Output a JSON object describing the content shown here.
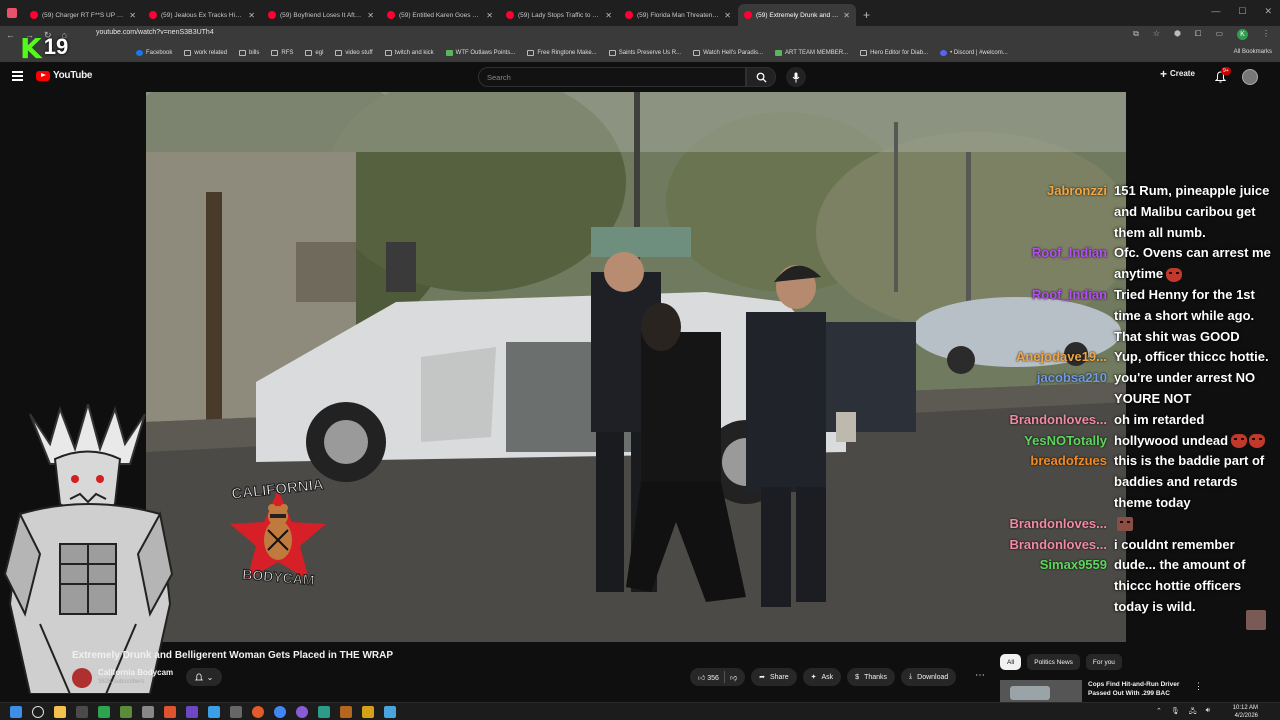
{
  "browser": {
    "tabs": [
      {
        "label": "(59) Charger RT F**S UP Calif"
      },
      {
        "label": "(59) Jealous Ex Tracks His Loser"
      },
      {
        "label": "(59) Boyfriend Loses It After He"
      },
      {
        "label": "(59) Entitled Karen Goes Ballist"
      },
      {
        "label": "(59) Lady Stops Traffic to Help I"
      },
      {
        "label": "(59) Florida Man Threatens Off"
      },
      {
        "label": "(59) Extremely Drunk and Bel"
      }
    ],
    "url": "youtube.com/watch?v=nenS3B3UTh4",
    "bookmarks": [
      {
        "label": "Facebook",
        "icon": "facebook-icon"
      },
      {
        "label": "work related",
        "icon": "folder-icon"
      },
      {
        "label": "bills",
        "icon": "folder-icon"
      },
      {
        "label": "RFS",
        "icon": "folder-icon"
      },
      {
        "label": "egl",
        "icon": "folder-icon"
      },
      {
        "label": "video stuff",
        "icon": "folder-icon"
      },
      {
        "label": "twitch and kick",
        "icon": "folder-icon"
      },
      {
        "label": "WTF Outlaws Points...",
        "icon": "green-icon"
      },
      {
        "label": "Free Ringtone Make...",
        "icon": "page-icon"
      },
      {
        "label": "Saints Preserve Us R...",
        "icon": "page-icon"
      },
      {
        "label": "Watch Hell's Paradis...",
        "icon": "page-icon"
      },
      {
        "label": "ART TEAM MEMBER...",
        "icon": "green-icon"
      },
      {
        "label": "Hero Editor for Diab...",
        "icon": "page-icon"
      },
      {
        "label": "• Discord | #welcom...",
        "icon": "discord-icon"
      }
    ],
    "all_bookmarks": "All Bookmarks",
    "profile_initial": "K"
  },
  "youtube": {
    "logo_text": "YouTube",
    "search_placeholder": "Search",
    "create_label": "Create",
    "notif_count": "9+"
  },
  "overlay": {
    "k_letter": "K",
    "counter": "19",
    "logo_top": "CALIFORNIA",
    "logo_bottom": "BODYCAM"
  },
  "chat": [
    {
      "user": "Jabronzzi",
      "color": "#f0a646",
      "text": "151 Rum, pineapple juice and Malibu caribou get them all numb."
    },
    {
      "user": "Roof_Indian",
      "color": "#b44ef0",
      "text": "Ofc. Ovens can arrest me anytime",
      "emote": true
    },
    {
      "user": "Roof_Indian",
      "color": "#b44ef0",
      "text": "Tried Henny for the 1st time a short while ago. That shit was GOOD"
    },
    {
      "user": "Anejodave19...",
      "color": "#f0a646",
      "text": "Yup, officer thiccc hottie."
    },
    {
      "user": "jacobsa210",
      "color": "#6e9ae6",
      "text": "you're under arrest NO YOURE NOT"
    },
    {
      "user": "Brandonloves...",
      "color": "#f08aa5",
      "text": "oh im retarded"
    },
    {
      "user": "YesNOTotally",
      "color": "#5cd65c",
      "text": "hollywood undead",
      "emote": true,
      "emote2": true
    },
    {
      "user": "breadofzues",
      "color": "#f08a24",
      "text": "this is the baddie part of baddies and retards theme today"
    },
    {
      "user": "Brandonloves...",
      "color": "#f08aa5",
      "text": "",
      "emote": true,
      "square": true
    },
    {
      "user": "Brandonloves...",
      "color": "#f08aa5",
      "text": "i couldnt remember"
    },
    {
      "user": "Simax9559",
      "color": "#5cd65c",
      "text": "dude... the amount of thiccc hottie officers today is wild."
    }
  ],
  "video_info": {
    "title": "Extremely Drunk and Belligerent Woman Gets Placed in THE WRAP",
    "channel": "California Bodycam",
    "subs": "362K subscribers",
    "likes": "356",
    "share": "Share",
    "ask": "Ask",
    "thanks": "Thanks",
    "download": "Download"
  },
  "sidebar": {
    "chips": [
      "All",
      "Politics News",
      "For you"
    ],
    "rec_title": "Cops Find Hit-and-Run Driver Passed Out With .299 BAC"
  },
  "taskbar": {
    "time": "10:12 AM",
    "date": "4/2/2026"
  },
  "colors": {
    "yt_red": "#ff0000",
    "kick_green": "#53fc18",
    "bg": "#0f0f0f"
  }
}
